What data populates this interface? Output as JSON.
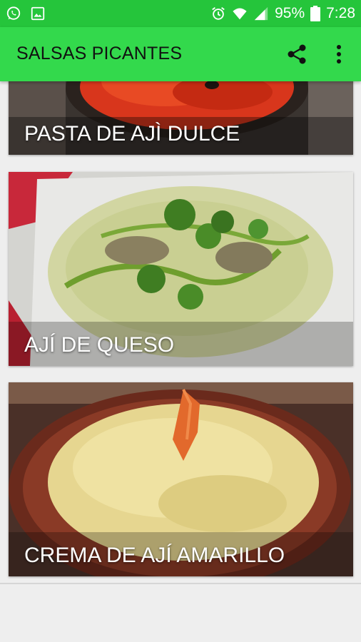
{
  "status_bar": {
    "icons_left": [
      "whatsapp-icon",
      "gallery-icon"
    ],
    "icons_right": [
      "alarm-icon",
      "wifi-icon",
      "signal-icon",
      "battery-icon"
    ],
    "battery": "95%",
    "time": "7:28"
  },
  "app_bar": {
    "title": "SALSAS PICANTES",
    "actions": [
      "share-icon",
      "more-vert-icon"
    ]
  },
  "recipes": [
    {
      "label": "PASTA DE AJÌ DULCE"
    },
    {
      "label": "AJÍ DE QUESO"
    },
    {
      "label": "CREMA DE AJÍ AMARILLO"
    }
  ],
  "colors": {
    "status_bar": "#25c53b",
    "app_bar": "#33d94c",
    "background": "#eeeeee"
  }
}
